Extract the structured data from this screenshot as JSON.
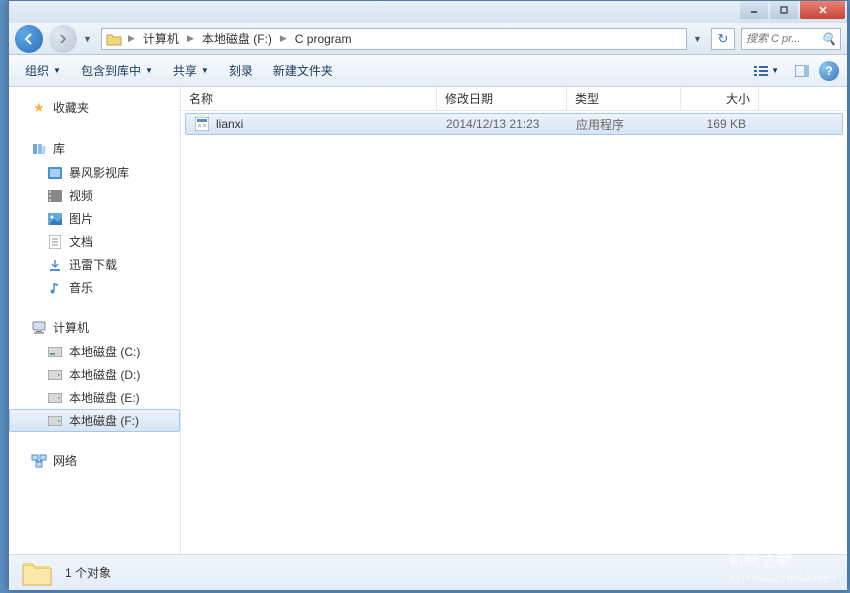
{
  "breadcrumb": {
    "items": [
      "计算机",
      "本地磁盘 (F:)",
      "C program"
    ]
  },
  "search": {
    "placeholder": "搜索 C pr..."
  },
  "toolbar": {
    "organize": "组织",
    "include": "包含到库中",
    "share": "共享",
    "burn": "刻录",
    "newfolder": "新建文件夹"
  },
  "sidebar": {
    "favorites": {
      "label": "收藏夹"
    },
    "libraries": {
      "label": "库",
      "items": [
        "暴风影视库",
        "视频",
        "图片",
        "文档",
        "迅雷下载",
        "音乐"
      ]
    },
    "computer": {
      "label": "计算机",
      "items": [
        "本地磁盘 (C:)",
        "本地磁盘 (D:)",
        "本地磁盘 (E:)",
        "本地磁盘 (F:)"
      ]
    },
    "network": {
      "label": "网络"
    }
  },
  "columns": {
    "name": "名称",
    "date": "修改日期",
    "type": "类型",
    "size": "大小"
  },
  "files": [
    {
      "name": "lianxi",
      "date": "2014/12/13 21:23",
      "type": "应用程序",
      "size": "169 KB"
    }
  ],
  "status": {
    "count": "1 个对象"
  },
  "watermark": {
    "cn": "系统之家",
    "en": "XITONGZHIJIA.NET"
  }
}
